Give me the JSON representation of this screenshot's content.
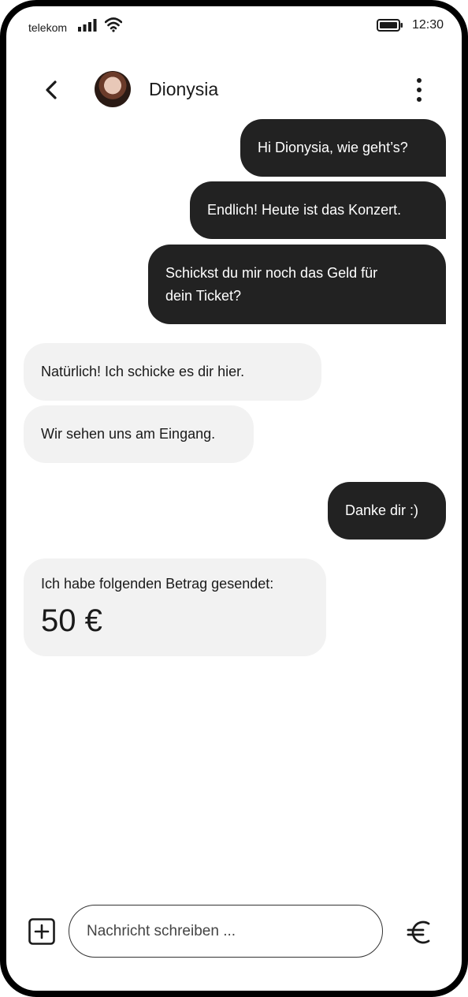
{
  "status_bar": {
    "carrier": "telekom",
    "time": "12:30",
    "icons": [
      "signal-icon",
      "wifi-icon",
      "battery-icon"
    ]
  },
  "header": {
    "contact_name": "Dionysia",
    "icons": [
      "back-arrow-icon",
      "avatar",
      "more-vertical-icon"
    ]
  },
  "messages": [
    {
      "direction": "outgoing",
      "text": "Hi Dionysia, wie geht’s?"
    },
    {
      "direction": "outgoing",
      "text": "Endlich! Heute ist das Konzert."
    },
    {
      "direction": "outgoing",
      "text_line1": "Schickst du mir noch das Geld für",
      "text_line2": "dein Ticket?"
    },
    {
      "direction": "incoming",
      "text": "Natürlich! Ich schicke es dir hier."
    },
    {
      "direction": "incoming",
      "text": "Wir sehen uns am Eingang."
    },
    {
      "direction": "outgoing",
      "text": "Danke dir :)"
    },
    {
      "direction": "incoming",
      "label": "Ich habe folgenden Betrag gesendet:",
      "amount": "50 €"
    }
  ],
  "composer": {
    "placeholder": "Nachricht schreiben ...",
    "icons": [
      "add-square-icon",
      "euro-icon"
    ]
  },
  "colors": {
    "outgoing_bubble": "#222222",
    "incoming_bubble": "#f2f2f2",
    "frame": "#000000"
  }
}
